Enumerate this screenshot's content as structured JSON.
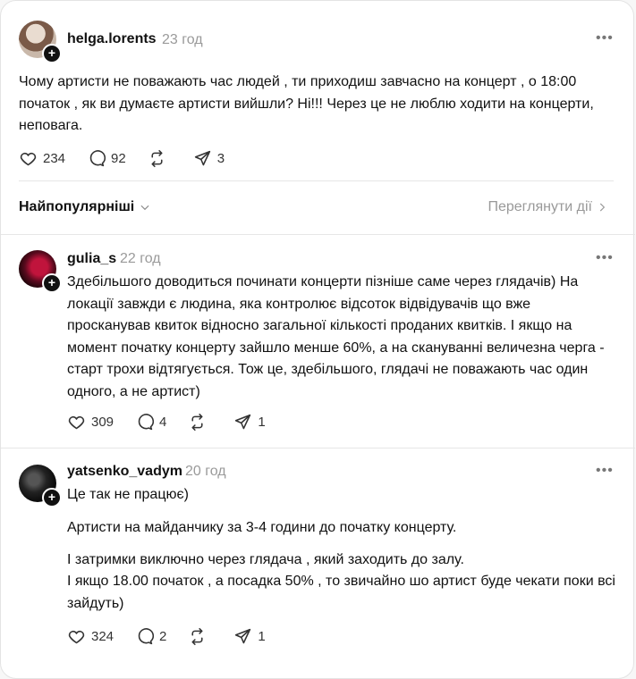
{
  "posts": [
    {
      "username": "helga.lorents",
      "time": "23 год",
      "text": "Чому артисти не поважають час людей , ти приходиш завчасно на концерт , о 18:00 початок , як ви думаєте артисти вийшли? Ні!!! Через це не люблю ходити на концерти, неповага.",
      "likes": "234",
      "comments": "92",
      "shares": "3"
    }
  ],
  "filter": {
    "label": "Найпопулярніші",
    "view_activity": "Переглянути дії"
  },
  "replies": [
    {
      "username": "gulia_s",
      "time": "22 год",
      "text": "Здебільшого доводиться починати концерти пізніше саме через глядачів) На локації завжди є людина, яка контролює відсоток відвідувачів що вже просканував квиток відносно загальної кількості проданих квитків. І якщо на момент початку концерту зайшло менше 60%, а на скануванні величезна черга - старт трохи відтягується. Тож це, здебільшого, глядачі не поважають час один одного, а не артист)",
      "likes": "309",
      "comments": "4",
      "shares": "1"
    },
    {
      "username": "yatsenko_vadym",
      "time": "20 год",
      "lines": [
        "Це так не працює)",
        "Артисти на майданчику за 3-4 години до початку концерту.",
        "І затримки виключно через глядача , який заходить до залу.",
        "І якщо 18.00 початок , а посадка 50% , то звичайно шо артист буде чекати поки всі зайдуть)"
      ],
      "likes": "324",
      "comments": "2",
      "shares": "1"
    }
  ]
}
